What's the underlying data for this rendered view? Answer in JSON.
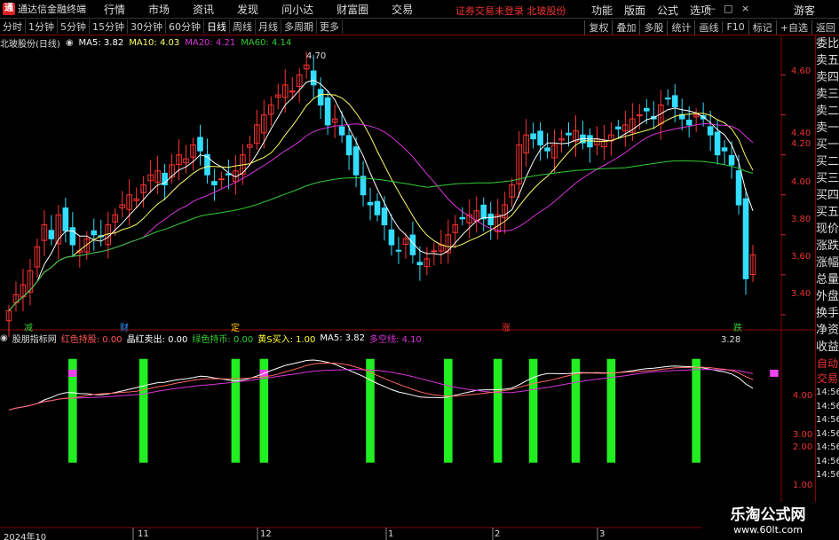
{
  "window": {
    "app_name": "通达信金融终端",
    "menu": [
      "行情",
      "市场",
      "资讯",
      "发现",
      "问小达",
      "财富圈",
      "交易"
    ],
    "notice": "证券交易未登录  北玻股份",
    "right_menu": [
      "功能",
      "版面",
      "公式",
      "选项"
    ],
    "controls": [
      "—",
      "□",
      "×"
    ],
    "guest": "游客"
  },
  "toolbar": {
    "periods": [
      "分时",
      "1分钟",
      "5分钟",
      "15分钟",
      "30分钟",
      "60分钟",
      "日线",
      "周线",
      "月线",
      "多周期",
      "更多"
    ],
    "active_period": "日线",
    "right": [
      "复权",
      "叠加",
      "多股",
      "统计",
      "画线",
      "F10",
      "标记",
      "+自选",
      "返回"
    ]
  },
  "main_chart": {
    "title": "北玻股份(日线)",
    "ma": [
      {
        "label": "MA5: 3.82",
        "color": "#ffffff"
      },
      {
        "label": "MA10: 4.03",
        "color": "#ffff66"
      },
      {
        "label": "MA20: 4.21",
        "color": "#dd33dd"
      },
      {
        "label": "MA60: 4.14",
        "color": "#33cc33"
      }
    ],
    "high_label": "4.70",
    "low_label": "3.28",
    "price_ticks": [
      "4.60",
      "4.40",
      "4.20",
      "4.00",
      "3.80",
      "3.60",
      "3.40"
    ],
    "markers": [
      {
        "text": "减",
        "color": "#33cc33"
      },
      {
        "text": "财",
        "color": "#3399ff"
      },
      {
        "text": "定",
        "color": "#ffcc00"
      },
      {
        "text": "涨",
        "color": "#ff3333"
      },
      {
        "text": "跌",
        "color": "#33cc33"
      }
    ]
  },
  "sub_chart": {
    "title": "股朋指标网",
    "fields": [
      {
        "label": "红色持股: 0.00",
        "color": "#ff5555"
      },
      {
        "label": "晶红卖出: 0.00",
        "color": "#ffffff"
      },
      {
        "label": "绿色持币: 0.00",
        "color": "#33cc33"
      },
      {
        "label": "黄S买入: 1.00",
        "color": "#ffff33"
      },
      {
        "label": "MA5: 3.82",
        "color": "#ffffff"
      },
      {
        "label": "多空线: 4.10",
        "color": "#dd33dd"
      }
    ],
    "ticks": [
      "4.00",
      "3.00",
      "2.00",
      "1.00"
    ]
  },
  "x_dates": [
    "2024年10",
    "11",
    "12",
    "1",
    "2",
    "3"
  ],
  "right_panel": [
    "委比",
    "卖五",
    "卖四",
    "卖三",
    "卖二",
    "卖一",
    "买一",
    "买二",
    "买三",
    "买四",
    "买五",
    "现价",
    "涨跌",
    "涨幅",
    "总量",
    "外盘",
    "换手",
    "净资",
    "收益"
  ],
  "right_panel2": [
    "自动",
    "交易",
    "14:56",
    "14:56",
    "14:56",
    "14:56",
    "14:56",
    "14:56",
    "14:56",
    "14:56"
  ],
  "watermark": {
    "line1": "乐淘公式网",
    "line2": "www.60lt.com"
  },
  "chart_data": {
    "type": "candlestick",
    "closes": [
      3.42,
      3.5,
      3.55,
      3.62,
      3.74,
      3.85,
      3.78,
      3.9,
      3.82,
      3.75,
      3.72,
      3.78,
      3.8,
      3.79,
      3.85,
      3.9,
      3.95,
      4.0,
      3.98,
      4.05,
      4.1,
      4.12,
      4.05,
      4.15,
      4.2,
      4.18,
      4.25,
      4.22,
      4.1,
      4.05,
      4.08,
      4.1,
      4.12,
      4.2,
      4.25,
      4.35,
      4.4,
      4.45,
      4.5,
      4.55,
      4.52,
      4.6,
      4.65,
      4.55,
      4.45,
      4.35,
      4.38,
      4.3,
      4.2,
      4.1,
      4.0,
      3.95,
      3.9,
      3.85,
      3.75,
      3.72,
      3.78,
      3.7,
      3.65,
      3.68,
      3.72,
      3.75,
      3.8,
      3.85,
      3.88,
      3.9,
      3.92,
      3.88,
      3.85,
      3.9,
      3.95,
      4.05,
      4.25,
      4.3,
      4.28,
      4.25,
      4.22,
      4.25,
      4.28,
      4.3,
      4.32,
      4.26,
      4.24,
      4.28,
      4.27,
      4.3,
      4.33,
      4.35,
      4.38,
      4.4,
      4.42,
      4.38,
      4.45,
      4.48,
      4.44,
      4.38,
      4.35,
      4.4,
      4.38,
      4.3,
      4.2,
      4.22,
      4.15,
      3.95,
      3.58,
      3.7
    ],
    "ylim": [
      3.28,
      4.7
    ]
  }
}
